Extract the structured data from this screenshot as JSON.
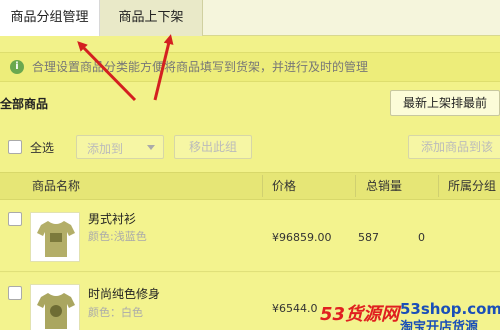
{
  "tabs": [
    {
      "label": "商品分组管理",
      "active": true
    },
    {
      "label": "商品上下架",
      "active": false
    }
  ],
  "notice": {
    "text": "合理设置商品分类能方便将商品填写到货架，并进行及时的管理"
  },
  "section": {
    "title": "全部商品",
    "sort_label": "最新上架排最前"
  },
  "toolbar": {
    "select_all": "全选",
    "add_to": "添加到",
    "remove": "移出此组",
    "add_goods": "添加商品到该"
  },
  "table": {
    "columns": [
      "商品名称",
      "价格",
      "总销量",
      "所属分组"
    ],
    "rows": [
      {
        "name": "男式衬衫",
        "color": "颜色:浅蓝色",
        "price": "¥96859.00",
        "sales": "587",
        "group": "0"
      },
      {
        "name": "时尚纯色修身",
        "color": "颜色：白色",
        "price": "¥6544.0",
        "sales": "",
        "group": ""
      }
    ]
  },
  "watermark": {
    "number": "53货源网",
    "site": "53shop.com",
    "slogan": "淘宝开店货源"
  },
  "colors": {
    "highlight": "#f2f28a",
    "arrow": "#d42020",
    "notice_icon": "#6aa84f"
  }
}
